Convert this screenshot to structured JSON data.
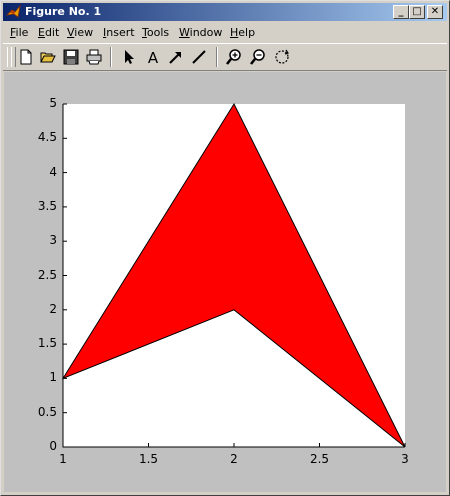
{
  "window": {
    "title": "Figure No. 1",
    "controls": {
      "minimize": "_",
      "maximize": "□",
      "close": "✕"
    }
  },
  "menu": [
    {
      "key": "F",
      "rest": "ile"
    },
    {
      "key": "E",
      "rest": "dit"
    },
    {
      "key": "V",
      "rest": "iew"
    },
    {
      "key": "I",
      "rest": "nsert"
    },
    {
      "key": "T",
      "rest": "ools"
    },
    {
      "key": "W",
      "rest": "indow"
    },
    {
      "key": "H",
      "rest": "elp"
    }
  ],
  "toolbar": {
    "icons": [
      "new-file-icon",
      "open-folder-icon",
      "save-icon",
      "print-icon",
      "arrow-cursor-icon",
      "insert-text-icon",
      "insert-arrow-icon",
      "insert-line-icon",
      "zoom-in-icon",
      "zoom-out-icon",
      "rotate-icon"
    ],
    "text_icon_glyph": "A"
  },
  "chart_data": {
    "type": "area",
    "xlim": [
      1,
      3
    ],
    "ylim": [
      0,
      5
    ],
    "xticks": [
      "1",
      "1.5",
      "2",
      "2.5",
      "3"
    ],
    "yticks": [
      "0",
      "0.5",
      "1",
      "1.5",
      "2",
      "2.5",
      "3",
      "3.5",
      "4",
      "4.5",
      "5"
    ],
    "polygon": {
      "x": [
        1,
        2,
        3,
        2,
        1
      ],
      "y": [
        1,
        5,
        0,
        2,
        1
      ],
      "fill": "#ff0000",
      "edge": "#000000"
    },
    "grid": false
  }
}
